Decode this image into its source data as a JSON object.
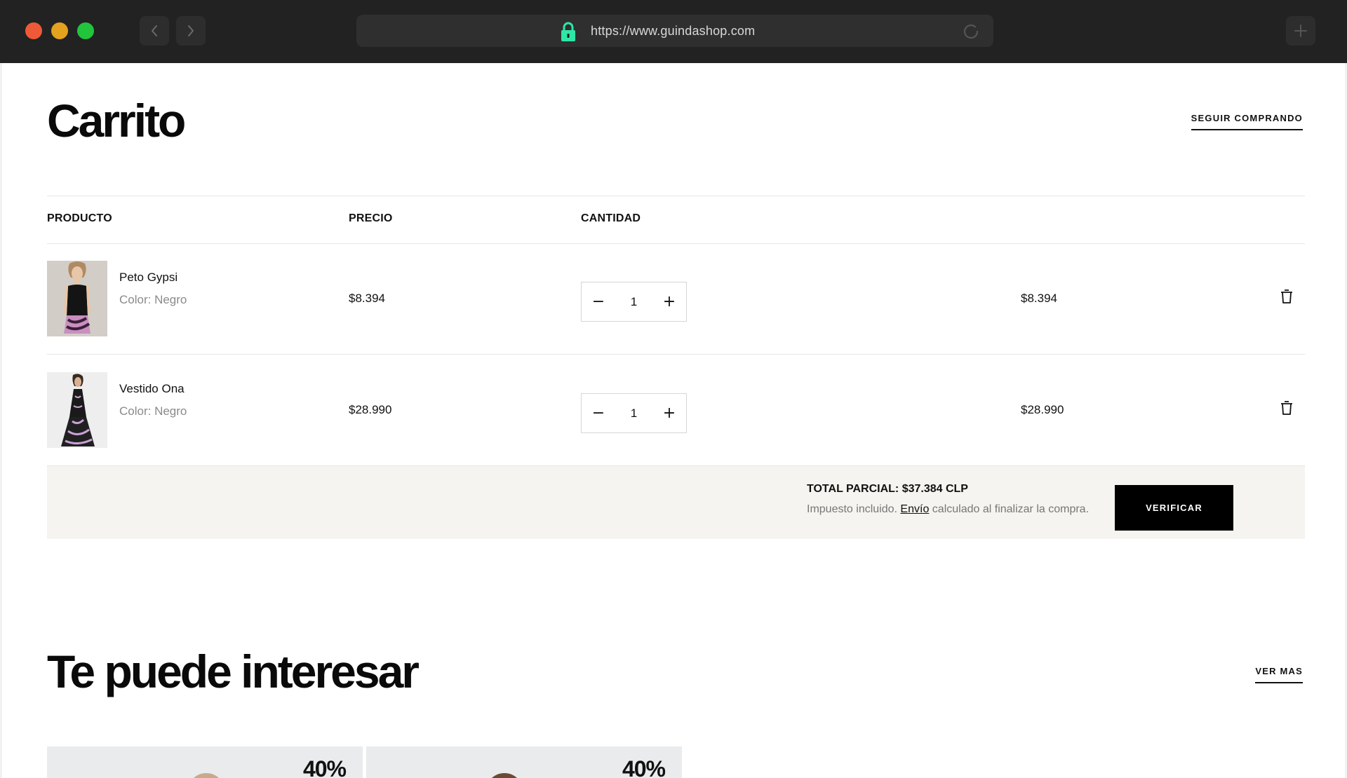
{
  "browser": {
    "url": "https://www.guindashop.com"
  },
  "cart": {
    "title": "Carrito",
    "continue_label": "SEGUIR COMPRANDO",
    "columns": [
      "PRODUCTO",
      "PRECIO",
      "CANTIDAD"
    ],
    "items": [
      {
        "name": "Peto Gypsi",
        "color": "Color: Negro",
        "price": "$8.394",
        "quantity": "1",
        "total": "$8.394"
      },
      {
        "name": "Vestido Ona",
        "color": "Color: Negro",
        "price": "$28.990",
        "quantity": "1",
        "total": "$28.990"
      }
    ],
    "subtotal": "TOTAL PARCIAL: $37.384 CLP",
    "tax_prefix": "Impuesto incluido.",
    "shipping_link": "Envío",
    "tax_suffix": "calculado al finalizar la compra.",
    "checkout_label": "VERIFICAR"
  },
  "recommendations": {
    "title": "Te puede interesar",
    "more_label": "VER MAS",
    "cards": [
      {
        "badge": "40%"
      },
      {
        "badge": "40%"
      }
    ]
  },
  "colors": {
    "chrome": "#222222",
    "lock": "#2ee6a6",
    "summary_bg": "#f6f4f0",
    "button": "#000000"
  }
}
